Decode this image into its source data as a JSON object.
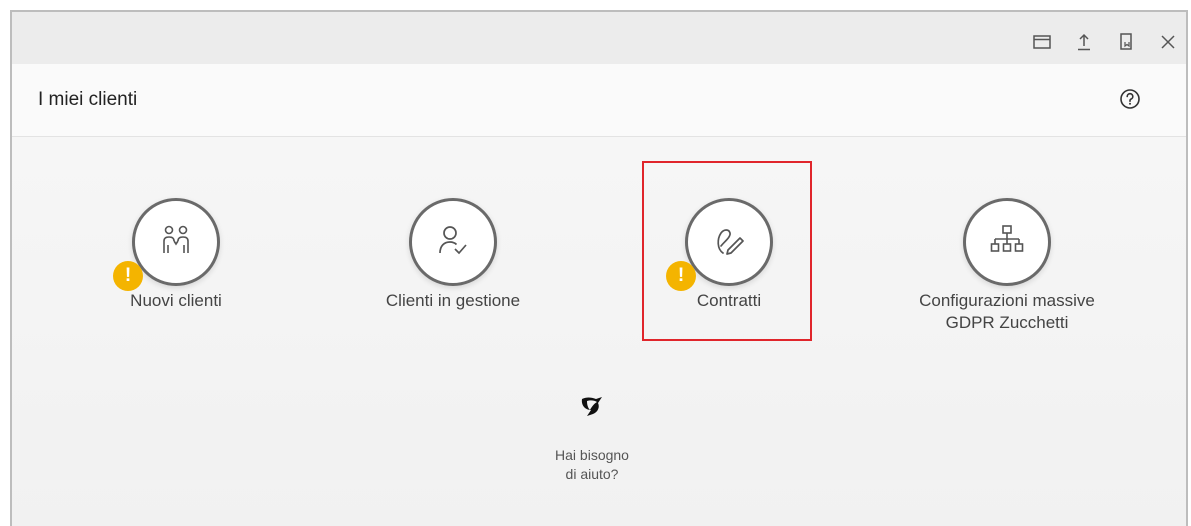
{
  "window": {
    "titlebar_icons": [
      "window-icon",
      "upload-icon",
      "bookmark-icon",
      "close-icon"
    ]
  },
  "header": {
    "title": "I miei clienti",
    "help_icon": "help-circle-icon"
  },
  "tiles": [
    {
      "label": "Nuovi clienti",
      "icon": "people-icon",
      "warning": true,
      "warning_symbol": "!"
    },
    {
      "label": "Clienti in gestione",
      "icon": "user-check-icon",
      "warning": false
    },
    {
      "label": "Contratti",
      "icon": "signature-icon",
      "warning": true,
      "warning_symbol": "!",
      "highlighted": true
    },
    {
      "label_line1": "Configurazioni massive",
      "label_line2": "GDPR Zucchetti",
      "icon": "org-chart-icon",
      "warning": false
    }
  ],
  "help": {
    "line1": "Hai bisogno",
    "line2": "di aiuto?",
    "icon": "zucchetti-logo-icon"
  },
  "colors": {
    "warning": "#f4b400",
    "highlight": "#e0252b",
    "icon_stroke": "#6a6a6a"
  }
}
